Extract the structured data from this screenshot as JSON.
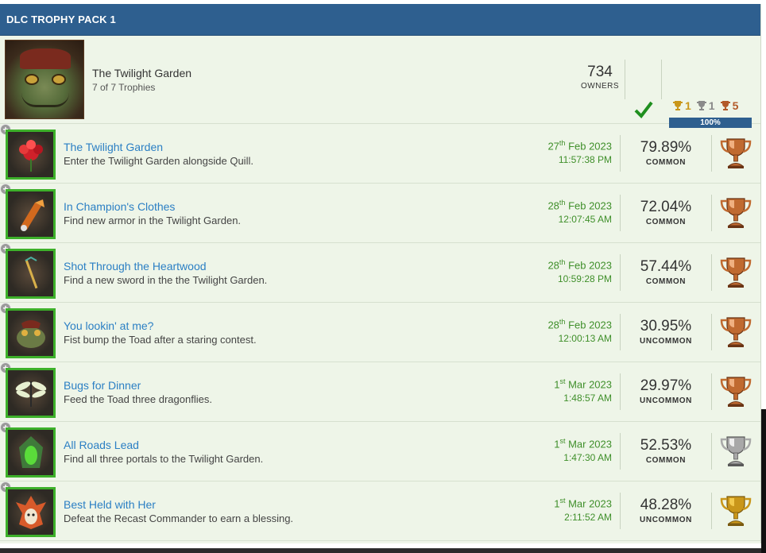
{
  "header": {
    "title": "DLC TROPHY PACK 1"
  },
  "group": {
    "name": "The Twilight Garden",
    "subtitle": "7 of 7 Trophies",
    "owners": "734",
    "owners_label": "OWNERS",
    "counts": {
      "gold": "1",
      "silver": "1",
      "bronze": "5"
    },
    "progress": "100%"
  },
  "colors": {
    "gold": "#c9961a",
    "silver": "#8a8a8a",
    "bronze": "#b06a2e",
    "link": "#2b7fc4",
    "date": "#3f8f2a",
    "header": "#2e5f8f"
  },
  "trophies": [
    {
      "title": "The Twilight Garden",
      "desc": "Enter the Twilight Garden alongside Quill.",
      "day": "27",
      "suffix": "th",
      "monthyear": "Feb 2023",
      "time": "11:57:38 PM",
      "pct": "79.89%",
      "rarity": "COMMON",
      "type": "bronze",
      "icon": "red-flower-icon"
    },
    {
      "title": "In Champion's Clothes",
      "desc": "Find new armor in the Twilight Garden.",
      "day": "28",
      "suffix": "th",
      "monthyear": "Feb 2023",
      "time": "12:07:45 AM",
      "pct": "72.04%",
      "rarity": "COMMON",
      "type": "bronze",
      "icon": "armor-icon"
    },
    {
      "title": "Shot Through the Heartwood",
      "desc": "Find a new sword in the the Twilight Garden.",
      "day": "28",
      "suffix": "th",
      "monthyear": "Feb 2023",
      "time": "10:59:28 PM",
      "pct": "57.44%",
      "rarity": "COMMON",
      "type": "bronze",
      "icon": "sword-icon"
    },
    {
      "title": "You lookin' at me?",
      "desc": "Fist bump the Toad after a staring contest.",
      "day": "28",
      "suffix": "th",
      "monthyear": "Feb 2023",
      "time": "12:00:13 AM",
      "pct": "30.95%",
      "rarity": "UNCOMMON",
      "type": "bronze",
      "icon": "toad-icon"
    },
    {
      "title": "Bugs for Dinner",
      "desc": "Feed the Toad three dragonflies.",
      "day": "1",
      "suffix": "st",
      "monthyear": "Mar 2023",
      "time": "1:48:57 AM",
      "pct": "29.97%",
      "rarity": "UNCOMMON",
      "type": "bronze",
      "icon": "dragonfly-icon"
    },
    {
      "title": "All Roads Lead",
      "desc": "Find all three portals to the Twilight Garden.",
      "day": "1",
      "suffix": "st",
      "monthyear": "Mar 2023",
      "time": "1:47:30 AM",
      "pct": "52.53%",
      "rarity": "COMMON",
      "type": "silver",
      "icon": "portal-icon"
    },
    {
      "title": "Best Held with Her",
      "desc": "Defeat the Recast Commander to earn a blessing.",
      "day": "1",
      "suffix": "st",
      "monthyear": "Mar 2023",
      "time": "2:11:52 AM",
      "pct": "48.28%",
      "rarity": "UNCOMMON",
      "type": "gold",
      "icon": "commander-icon"
    }
  ]
}
